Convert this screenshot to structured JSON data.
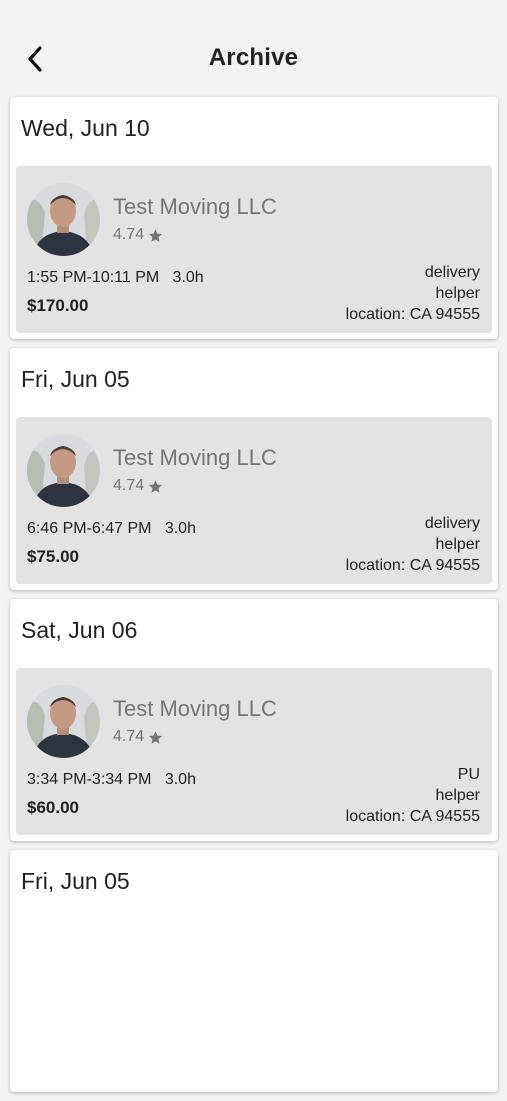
{
  "header": {
    "title": "Archive",
    "back_icon": "chevron-left-icon"
  },
  "days": [
    {
      "date": "Wed, Jun 10",
      "job": {
        "company": "Test Moving LLC",
        "rating": "4.74",
        "time": "1:55 PM-10:11 PM   3.0h",
        "price": "$170.00",
        "type": "delivery",
        "role": "helper",
        "location": "location: CA 94555"
      }
    },
    {
      "date": "Fri, Jun 05",
      "job": {
        "company": "Test Moving LLC",
        "rating": "4.74",
        "time": "6:46 PM-6:47 PM   3.0h",
        "price": "$75.00",
        "type": "delivery",
        "role": "helper",
        "location": "location: CA 94555"
      }
    },
    {
      "date": "Sat, Jun 06",
      "job": {
        "company": "Test Moving LLC",
        "rating": "4.74",
        "time": "3:34 PM-3:34 PM   3.0h",
        "price": "$60.00",
        "type": "PU",
        "role": "helper",
        "location": "location: CA 94555"
      }
    },
    {
      "date": "Fri, Jun 05"
    }
  ],
  "colors": {
    "background": "#f2f2f2",
    "card": "#ffffff",
    "tile": "#e3e3e3",
    "muted_text": "#757575"
  }
}
